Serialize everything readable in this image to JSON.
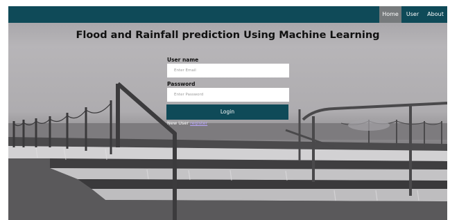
{
  "nav": {
    "home": "Home",
    "user": "User",
    "about": "About"
  },
  "page": {
    "title": "Flood and Rainfall prediction Using Machine Learning"
  },
  "form": {
    "username_label": "User name",
    "email_placeholder": "Enter Email",
    "email_value": "",
    "password_label": "Password",
    "password_placeholder": "Enter Password",
    "password_value": "",
    "login_label": "Login",
    "new_user_text": "New User ",
    "register_link": "register"
  },
  "colors": {
    "navbar": "#0f4a58",
    "active_nav": "#767a7c",
    "button": "#0f4a58",
    "link": "#b9a6ff"
  }
}
